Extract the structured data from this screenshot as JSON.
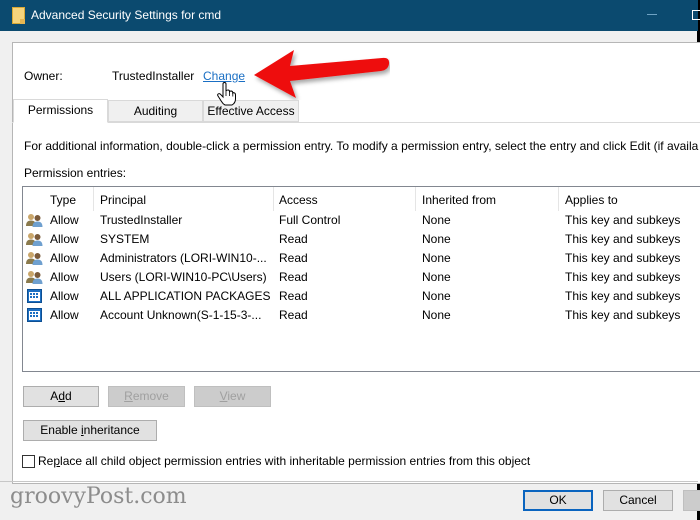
{
  "window": {
    "title": "Advanced Security Settings for cmd",
    "icon": "folder-icon"
  },
  "owner": {
    "label": "Owner:",
    "value": "TrustedInstaller",
    "change_link": "Change"
  },
  "tabs": [
    {
      "label": "Permissions",
      "active": true
    },
    {
      "label": "Auditing",
      "active": false
    },
    {
      "label": "Effective Access",
      "active": false
    }
  ],
  "info_text": "For additional information, double-click a permission entry. To modify a permission entry, select the entry and click Edit (if availa",
  "entries_label": "Permission entries:",
  "columns": [
    "Type",
    "Principal",
    "Access",
    "Inherited from",
    "Applies to"
  ],
  "entries": [
    {
      "icon": "users-icon",
      "type": "Allow",
      "principal": "TrustedInstaller",
      "access": "Full Control",
      "inherited_from": "None",
      "applies_to": "This key and subkeys"
    },
    {
      "icon": "users-icon",
      "type": "Allow",
      "principal": "SYSTEM",
      "access": "Read",
      "inherited_from": "None",
      "applies_to": "This key and subkeys"
    },
    {
      "icon": "users-icon",
      "type": "Allow",
      "principal": "Administrators (LORI-WIN10-...",
      "access": "Read",
      "inherited_from": "None",
      "applies_to": "This key and subkeys"
    },
    {
      "icon": "users-icon",
      "type": "Allow",
      "principal": "Users (LORI-WIN10-PC\\Users)",
      "access": "Read",
      "inherited_from": "None",
      "applies_to": "This key and subkeys"
    },
    {
      "icon": "app-package-icon",
      "type": "Allow",
      "principal": "ALL APPLICATION PACKAGES",
      "access": "Read",
      "inherited_from": "None",
      "applies_to": "This key and subkeys"
    },
    {
      "icon": "app-package-icon",
      "type": "Allow",
      "principal": "Account Unknown(S-1-15-3-...",
      "access": "Read",
      "inherited_from": "None",
      "applies_to": "This key and subkeys"
    }
  ],
  "buttons": {
    "add": {
      "pre": "A",
      "key": "d",
      "post": "d",
      "enabled": true
    },
    "remove": {
      "pre": "",
      "key": "R",
      "post": "emove",
      "enabled": false
    },
    "view": {
      "pre": "",
      "key": "V",
      "post": "iew",
      "enabled": false
    },
    "enable_inheritance": {
      "pre": "Enable ",
      "key": "i",
      "post": "nheritance",
      "enabled": true
    },
    "ok": "OK",
    "cancel": "Cancel"
  },
  "replace_checkbox": {
    "pre": "Re",
    "key": "p",
    "post": "lace all child object permission entries with inheritable permission entries from this object",
    "checked": false
  },
  "annotation": {
    "arrow_color": "#ee1111",
    "points_to": "owner.change_link"
  },
  "watermark": "groovyPost.com",
  "colors": {
    "titlebar": "#0b4a6f",
    "link": "#1a6fc4",
    "ok_border": "#0a64bf"
  }
}
